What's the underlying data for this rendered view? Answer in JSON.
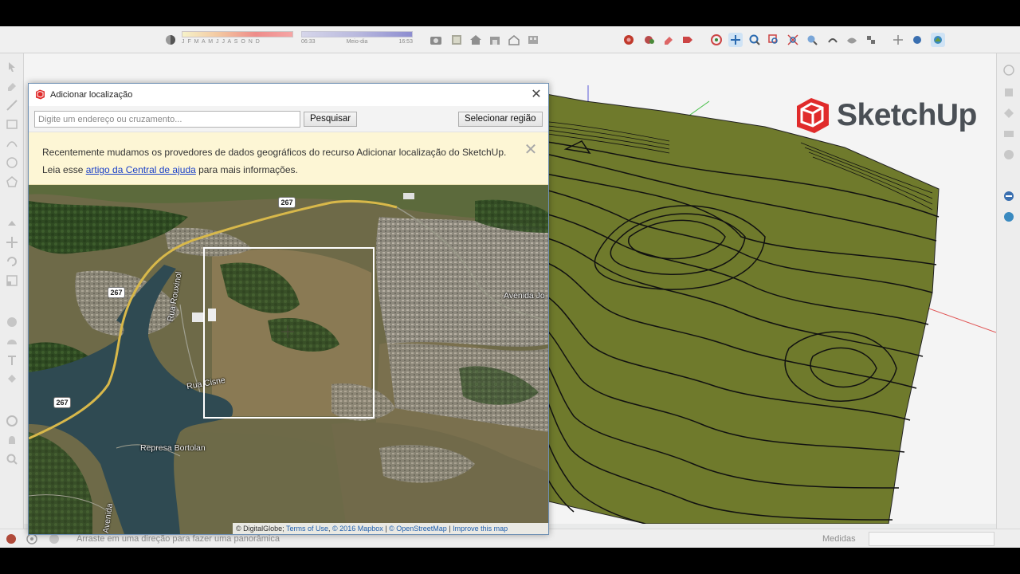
{
  "toolbar": {
    "shadow_months": "J F M A M J J A S O N D",
    "time_start": "06:33",
    "time_mid": "Meio-dia",
    "time_end": "16:53"
  },
  "logo": {
    "text": "SketchUp",
    "color": "#e02b2b"
  },
  "dialog": {
    "title": "Adicionar localização",
    "close_glyph": "✕",
    "search_placeholder": "Digite um endereço ou cruzamento...",
    "search_button": "Pesquisar",
    "select_region_button": "Selecionar região",
    "notice": {
      "text_before": "Recentemente mudamos os provedores de dados geográficos do recurso Adicionar localização do SketchUp. Leia esse ",
      "link": "artigo da Central de ajuda",
      "text_after": " para mais informações.",
      "close_glyph": "✕"
    },
    "map": {
      "shields": [
        "267",
        "267",
        "267"
      ],
      "labels": [
        "Avenida Jo",
        "Rua Rouxinol",
        "Rua Cisne",
        "Represa Bortolan",
        "Avenida"
      ],
      "attribution": {
        "digitalglobe": "© DigitalGlobe;",
        "terms": "Terms of Use",
        "mapbox": "© 2016 Mapbox",
        "sep1": "|",
        "osm": "© OpenStreetMap",
        "sep2": "|",
        "improve": "Improve this map"
      }
    }
  },
  "status": {
    "hint": "Arraste em uma direção para fazer uma panorâmica",
    "measure_label": "Medidas",
    "measure_value": ""
  },
  "colors": {
    "terrain": "#6f7a2c",
    "contour": "#111111",
    "accent": "#1a40c8"
  }
}
